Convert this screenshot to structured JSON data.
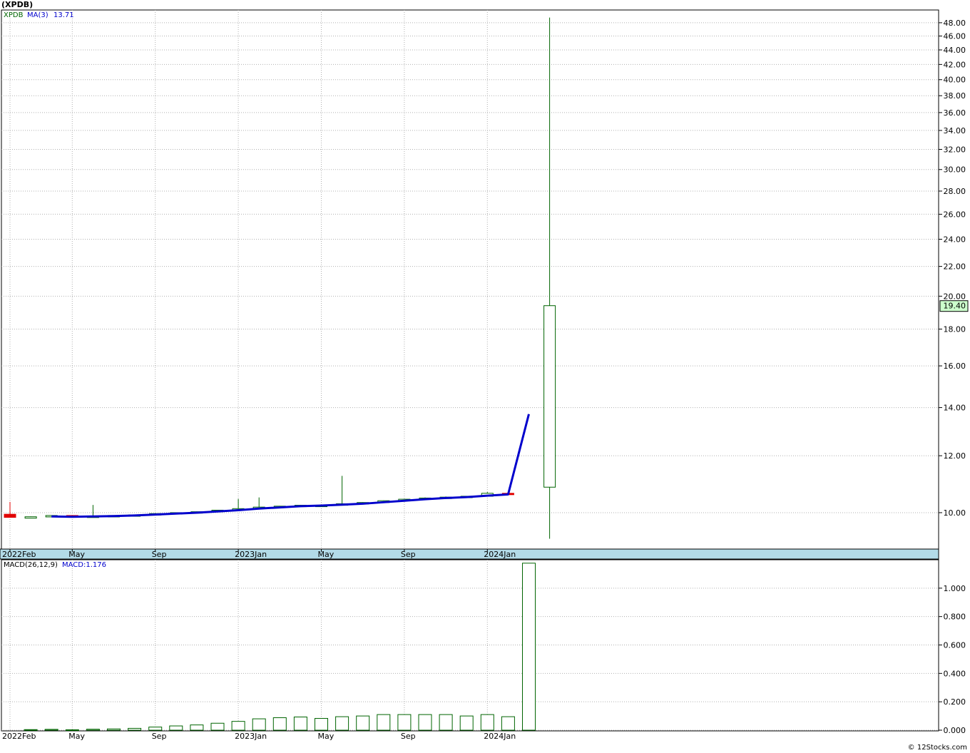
{
  "page": {
    "title": "(XPDB)",
    "credit": "© 12Stocks.com"
  },
  "colors": {
    "up": "#006400",
    "down": "#e00000",
    "ma": "#0000cc",
    "grid": "#b0b0b0",
    "axis_band": "#b3dbe8",
    "last_price_bg": "#ccffcc"
  },
  "chart_data": [
    {
      "type": "candlestick",
      "legend": {
        "symbol": "XPDB",
        "ma_label": "MA(3)",
        "ma_value": "13.71"
      },
      "last_price_label": "19.40",
      "y_scale": "log",
      "ylim": [
        8.9,
        50
      ],
      "y_ticks": [
        10,
        12,
        14,
        16,
        18,
        20,
        22,
        24,
        26,
        28,
        30,
        32,
        34,
        36,
        38,
        40,
        42,
        44,
        46,
        48
      ],
      "y_tick_labels": [
        "10.00",
        "12.00",
        "14.00",
        "16.00",
        "18.00",
        "20.00",
        "22.00",
        "24.00",
        "26.00",
        "28.00",
        "30.00",
        "32.00",
        "34.00",
        "36.00",
        "38.00",
        "40.00",
        "42.00",
        "44.00",
        "46.00",
        "48.00"
      ],
      "x_unit": "months since 2022 Feb",
      "xlim": [
        0,
        37
      ],
      "x_ticks": [
        0,
        3,
        7,
        11,
        15,
        19,
        23
      ],
      "x_tick_labels": [
        "2022Feb",
        "May",
        "Sep",
        "2023Jan",
        "May",
        "Sep",
        "2024Jan"
      ],
      "candles": [
        {
          "x": 0,
          "open": 9.95,
          "high": 10.35,
          "low": 9.85,
          "close": 9.85
        },
        {
          "x": 1,
          "open": 9.85,
          "high": 9.88,
          "low": 9.82,
          "close": 9.87
        },
        {
          "x": 2,
          "open": 9.87,
          "high": 9.92,
          "low": 9.86,
          "close": 9.91
        },
        {
          "x": 3,
          "open": 9.91,
          "high": 9.92,
          "low": 9.85,
          "close": 9.86
        },
        {
          "x": 4,
          "open": 9.86,
          "high": 10.25,
          "low": 9.86,
          "close": 9.89
        },
        {
          "x": 5,
          "open": 9.89,
          "high": 9.92,
          "low": 9.89,
          "close": 9.91
        },
        {
          "x": 6,
          "open": 9.91,
          "high": 9.94,
          "low": 9.91,
          "close": 9.93
        },
        {
          "x": 7,
          "open": 9.93,
          "high": 9.98,
          "low": 9.93,
          "close": 9.97
        },
        {
          "x": 8,
          "open": 9.97,
          "high": 10.01,
          "low": 9.97,
          "close": 10.0
        },
        {
          "x": 9,
          "open": 10.0,
          "high": 10.04,
          "low": 10.0,
          "close": 10.03
        },
        {
          "x": 10,
          "open": 10.03,
          "high": 10.09,
          "low": 10.03,
          "close": 10.08
        },
        {
          "x": 11,
          "open": 10.08,
          "high": 10.45,
          "low": 10.08,
          "close": 10.13
        },
        {
          "x": 12,
          "open": 10.13,
          "high": 10.5,
          "low": 10.13,
          "close": 10.18
        },
        {
          "x": 13,
          "open": 10.18,
          "high": 10.22,
          "low": 10.18,
          "close": 10.21
        },
        {
          "x": 14,
          "open": 10.21,
          "high": 10.25,
          "low": 10.21,
          "close": 10.24
        },
        {
          "x": 15,
          "open": 10.24,
          "high": 10.25,
          "low": 10.22,
          "close": 10.24
        },
        {
          "x": 16,
          "open": 10.24,
          "high": 11.25,
          "low": 10.24,
          "close": 10.29
        },
        {
          "x": 17,
          "open": 10.29,
          "high": 10.34,
          "low": 10.29,
          "close": 10.33
        },
        {
          "x": 18,
          "open": 10.33,
          "high": 10.4,
          "low": 10.33,
          "close": 10.39
        },
        {
          "x": 19,
          "open": 10.39,
          "high": 10.45,
          "low": 10.39,
          "close": 10.44
        },
        {
          "x": 20,
          "open": 10.44,
          "high": 10.5,
          "low": 10.44,
          "close": 10.48
        },
        {
          "x": 21,
          "open": 10.48,
          "high": 10.53,
          "low": 10.48,
          "close": 10.51
        },
        {
          "x": 22,
          "open": 10.51,
          "high": 10.55,
          "low": 10.51,
          "close": 10.54
        },
        {
          "x": 23,
          "open": 10.54,
          "high": 10.68,
          "low": 10.54,
          "close": 10.64
        },
        {
          "x": 24,
          "open": 10.64,
          "high": 10.66,
          "low": 10.59,
          "close": 10.62
        },
        {
          "x": 26,
          "open": 10.85,
          "high": 48.8,
          "low": 9.2,
          "close": 19.4
        }
      ],
      "ma_line": [
        {
          "x": 2,
          "y": 9.88
        },
        {
          "x": 3,
          "y": 9.87
        },
        {
          "x": 4,
          "y": 9.88
        },
        {
          "x": 5,
          "y": 9.89
        },
        {
          "x": 6,
          "y": 9.91
        },
        {
          "x": 7,
          "y": 9.94
        },
        {
          "x": 8,
          "y": 9.97
        },
        {
          "x": 9,
          "y": 10.0
        },
        {
          "x": 10,
          "y": 10.04
        },
        {
          "x": 11,
          "y": 10.08
        },
        {
          "x": 12,
          "y": 10.13
        },
        {
          "x": 13,
          "y": 10.17
        },
        {
          "x": 14,
          "y": 10.21
        },
        {
          "x": 15,
          "y": 10.23
        },
        {
          "x": 16,
          "y": 10.26
        },
        {
          "x": 17,
          "y": 10.29
        },
        {
          "x": 18,
          "y": 10.34
        },
        {
          "x": 19,
          "y": 10.39
        },
        {
          "x": 20,
          "y": 10.44
        },
        {
          "x": 21,
          "y": 10.48
        },
        {
          "x": 22,
          "y": 10.51
        },
        {
          "x": 23,
          "y": 10.56
        },
        {
          "x": 24,
          "y": 10.6
        },
        {
          "x": 25,
          "y": 13.71
        }
      ]
    },
    {
      "type": "bar",
      "legend": {
        "label": "MACD(26,12,9)",
        "value_label": "MACD:1.176"
      },
      "ylim": [
        -0.005,
        1.2
      ],
      "y_ticks": [
        0,
        0.2,
        0.4,
        0.6,
        0.8,
        1.0
      ],
      "y_tick_labels": [
        "0.000",
        "0.200",
        "0.400",
        "0.600",
        "0.800",
        "1.000"
      ],
      "x_tick_labels": [
        "2022Feb",
        "May",
        "Sep",
        "2023Jan",
        "May",
        "Sep",
        "2024Jan"
      ],
      "bars": [
        {
          "x": 1,
          "value": 0.004
        },
        {
          "x": 2,
          "value": 0.006
        },
        {
          "x": 3,
          "value": 0.003
        },
        {
          "x": 4,
          "value": 0.007
        },
        {
          "x": 5,
          "value": 0.009
        },
        {
          "x": 6,
          "value": 0.013
        },
        {
          "x": 7,
          "value": 0.022
        },
        {
          "x": 8,
          "value": 0.03
        },
        {
          "x": 9,
          "value": 0.037
        },
        {
          "x": 10,
          "value": 0.049
        },
        {
          "x": 11,
          "value": 0.062
        },
        {
          "x": 12,
          "value": 0.08
        },
        {
          "x": 13,
          "value": 0.088
        },
        {
          "x": 14,
          "value": 0.093
        },
        {
          "x": 15,
          "value": 0.083
        },
        {
          "x": 16,
          "value": 0.095
        },
        {
          "x": 17,
          "value": 0.1
        },
        {
          "x": 18,
          "value": 0.11
        },
        {
          "x": 19,
          "value": 0.11
        },
        {
          "x": 20,
          "value": 0.11
        },
        {
          "x": 21,
          "value": 0.11
        },
        {
          "x": 22,
          "value": 0.1
        },
        {
          "x": 23,
          "value": 0.11
        },
        {
          "x": 24,
          "value": 0.095
        },
        {
          "x": 25,
          "value": 1.176
        }
      ]
    }
  ]
}
